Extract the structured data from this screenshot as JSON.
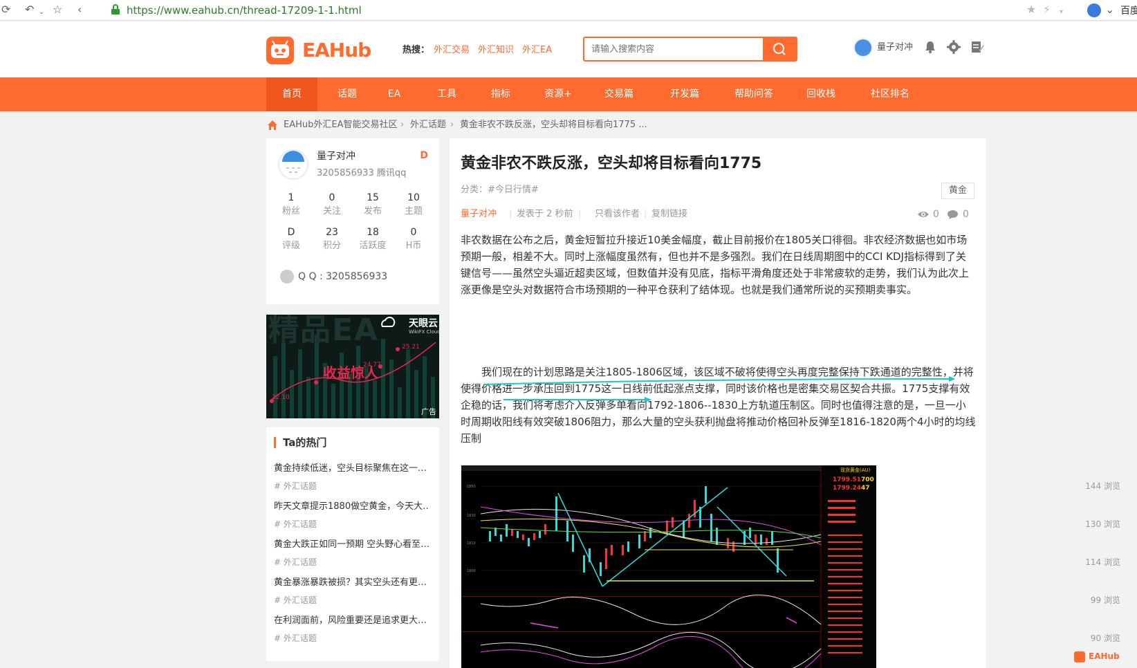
{
  "browser": {
    "url": "https://www.eahub.cn/thread-17209-1-1.html",
    "right_text": "百度"
  },
  "header": {
    "logo": "EAHub",
    "hot_label": "热搜：",
    "hot_links": [
      "外汇交易",
      "外汇知识",
      "外汇EA"
    ],
    "search_placeholder": "请输入搜索内容",
    "user": "量子对冲"
  },
  "nav": {
    "items": [
      "首页",
      "话题",
      "EA",
      "工具",
      "指标",
      "资源+",
      "交易篇",
      "开发篇",
      "帮助问答",
      "回收栈",
      "社区排名"
    ]
  },
  "breadcrumb": {
    "items": [
      "EAHub外汇EA智能交易社区",
      "外汇话题",
      "黄金非农不跌反涨，空头却将目标看向1775 ..."
    ],
    "separator": "›"
  },
  "profile": {
    "name": "量子对冲",
    "sub": "3205856933  腾讯qq",
    "grade": "D",
    "stats": [
      {
        "value": "1",
        "label": "粉丝"
      },
      {
        "value": "0",
        "label": "关注"
      },
      {
        "value": "15",
        "label": "发布"
      },
      {
        "value": "10",
        "label": "主题"
      },
      {
        "value": "D",
        "label": "评级"
      },
      {
        "value": "23",
        "label": "积分"
      },
      {
        "value": "18",
        "label": "活跃度"
      },
      {
        "value": "0",
        "label": "H币"
      }
    ],
    "qq": "Q Q : 3205856933"
  },
  "ad": {
    "title": "精品EA",
    "brand": "天眼云",
    "brand_sub": "WikiFX Cloud",
    "slogan": "收益惊人",
    "label": "广告",
    "values": [
      "25.21",
      "24.77",
      "22.10"
    ]
  },
  "hot": {
    "title": "Ta的热门",
    "items": [
      {
        "title": "黄金持续低迷，空头目标聚焦在这一…",
        "cat": "# 外汇话题",
        "views": "144 浏览"
      },
      {
        "title": "昨天文章提示1880做空黄金，今天大…",
        "cat": "# 外汇话题",
        "views": "130 浏览"
      },
      {
        "title": "黄金大跌正如同一预期 空头野心看至…",
        "cat": "# 外汇话题",
        "views": "114 浏览"
      },
      {
        "title": "黄金暴涨暴跌被损？其实空头还有更…",
        "cat": "# 外汇话题",
        "views": "99 浏览"
      },
      {
        "title": "在利润面前，风险重要还是追求更大…",
        "cat": "# 外汇话题",
        "views": "90 浏览"
      }
    ]
  },
  "article": {
    "title": "黄金非农不跌反涨，空头却将目标看向1775",
    "category": "分类：#今日行情#",
    "tag": "黄金",
    "author": "量子对冲",
    "posted": "发表于 2 秒前",
    "only_author": "只看该作者",
    "copy_link": "复制链接",
    "views": "0",
    "comments": "0",
    "para1": "非农数据在公布之后，黄金短暂拉升接近10美金幅度，截止目前报价在1805关口徘徊。非农经济数据也如市场预期一般，相差不大。同时上涨幅度虽然有，但也并不是多强烈。我们在日线周期图中的CCI KDJ指标得到了关键信号——虽然空头逼近超卖区域，但数值并没有见底，指标平滑角度还处于非常疲软的走势，我们认为此次上涨更像是空头对数据符合市场预期的一种平仓获利了结体现。也就是我们通常所说的买预期卖事实。",
    "para2": "我们现在的计划思路是关注1805-1806区域，该区域不破将使得空头再度完整保持下跌通道的完整性，并将使得价格进一步承压回到1775这一日线前低起涨点支撑，同时该价格也是密集交易区契合共振。1775支撑有效企稳的话，我们将考虑介入反弹多单看向1792-1806--1830上方轨道压制区。同时也值得注意的是，一旦一小时周期收阳线有效突破1806阻力，那么大量的空头获利抛盘将推动价格回补反弹至1816-1820两个4小时的均线压制"
  },
  "chart_panel": {
    "title": "现货黄金(AU)",
    "price1": "1799.51",
    "price1b": "700",
    "price2": "1799.24",
    "price2b": "47"
  },
  "watermark": "EAHub",
  "colors": {
    "brand": "#ff6a2f",
    "nav_active": "#f0551b",
    "annot": "#1cc7c7"
  }
}
